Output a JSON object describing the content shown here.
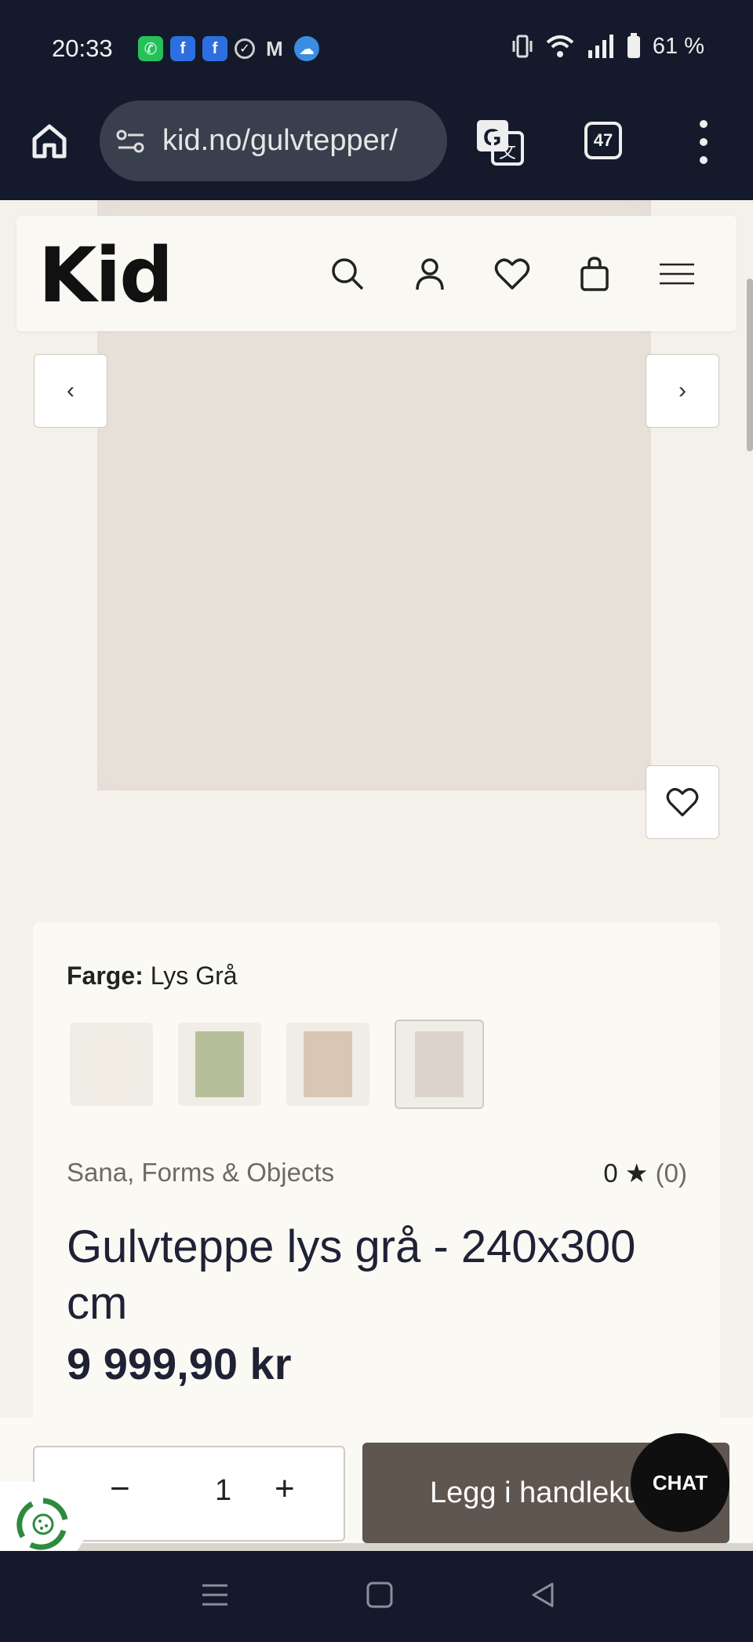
{
  "status_bar": {
    "time": "20:33",
    "battery": "61 %",
    "app_icons": [
      "whatsapp-icon",
      "facebook-icon",
      "facebook-icon",
      "check-circle-icon",
      "gmail-icon",
      "weather-icon"
    ]
  },
  "browser": {
    "url": "kid.no/gulvtepper/",
    "tab_count": "47"
  },
  "site": {
    "logo": "Kid",
    "header_icons": [
      "search-icon",
      "account-icon",
      "wishlist-heart-icon",
      "shopping-bag-icon",
      "hamburger-menu-icon"
    ]
  },
  "gallery": {
    "prev_label": "‹",
    "next_label": "›"
  },
  "product": {
    "color_label": "Farge:",
    "color_value": "Lys Grå",
    "swatches": [
      {
        "name": "hvit",
        "color": "#f1ede5"
      },
      {
        "name": "grønn",
        "color": "#b7bf9a"
      },
      {
        "name": "beige",
        "color": "#d9c6b4"
      },
      {
        "name": "lys grå",
        "color": "#dcd4cc",
        "active": true
      }
    ],
    "brand": "Sana, Forms & Objects",
    "rating_value": "0",
    "rating_star": "★",
    "rating_count": "(0)",
    "title": "Gulvteppe lys grå - 240x300 cm",
    "price": "9 999,90 kr"
  },
  "cart": {
    "minus": "−",
    "quantity": "1",
    "plus": "+",
    "add_label": "Legg i handlekurv",
    "chat_label": "CHAT"
  },
  "colors": {
    "status_bg": "#141a2b",
    "page_bg": "#f3f1ea",
    "rug": "#e8e1da",
    "button": "#5e564f"
  }
}
